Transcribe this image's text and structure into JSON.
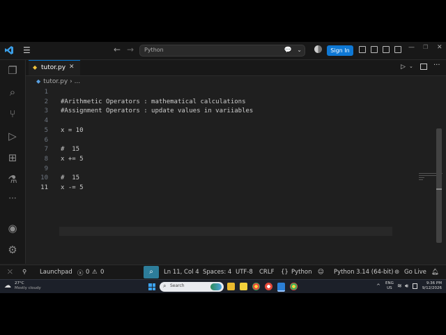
{
  "titlebar": {
    "search_text": "Python",
    "sign_in_label": "Sign In"
  },
  "tabs": [
    {
      "label": "tutor.py"
    }
  ],
  "breadcrumb": {
    "file": "tutor.py",
    "sep": "›",
    "rest": "..."
  },
  "editor": {
    "lines": [
      {
        "num": "1",
        "text": ""
      },
      {
        "num": "2",
        "text": "#Arithmetic Operators : mathematical calculations"
      },
      {
        "num": "3",
        "text": "#Assignment Operators : update values in variiables"
      },
      {
        "num": "4",
        "text": ""
      },
      {
        "num": "5",
        "text": "x = 10"
      },
      {
        "num": "6",
        "text": ""
      },
      {
        "num": "7",
        "text": "#  15"
      },
      {
        "num": "8",
        "text": "x += 5"
      },
      {
        "num": "9",
        "text": ""
      },
      {
        "num": "10",
        "text": "#  15"
      },
      {
        "num": "11",
        "text": "x -= 5"
      }
    ],
    "current_line": "11"
  },
  "statusbar": {
    "launchpad": "Launchpad",
    "errors": "0",
    "warnings": "0",
    "position": "Ln 11, Col 4",
    "spaces": "Spaces: 4",
    "encoding": "UTF-8",
    "eol": "CRLF",
    "lang_braces": "{}",
    "language": "Python",
    "interpreter": "Python 3.14 (64-bit)",
    "go_live": "Go Live"
  },
  "taskbar": {
    "weather_temp": "27°C",
    "weather_desc": "Mostly cloudy",
    "search_label": "Search",
    "lang_1": "ENG",
    "lang_2": "US",
    "time": "9:36 PM",
    "date": "9/12/2026"
  },
  "colors": {
    "accent": "#0e78d4",
    "editor_bg": "#1f1f1f",
    "chrome_bg": "#181818"
  }
}
